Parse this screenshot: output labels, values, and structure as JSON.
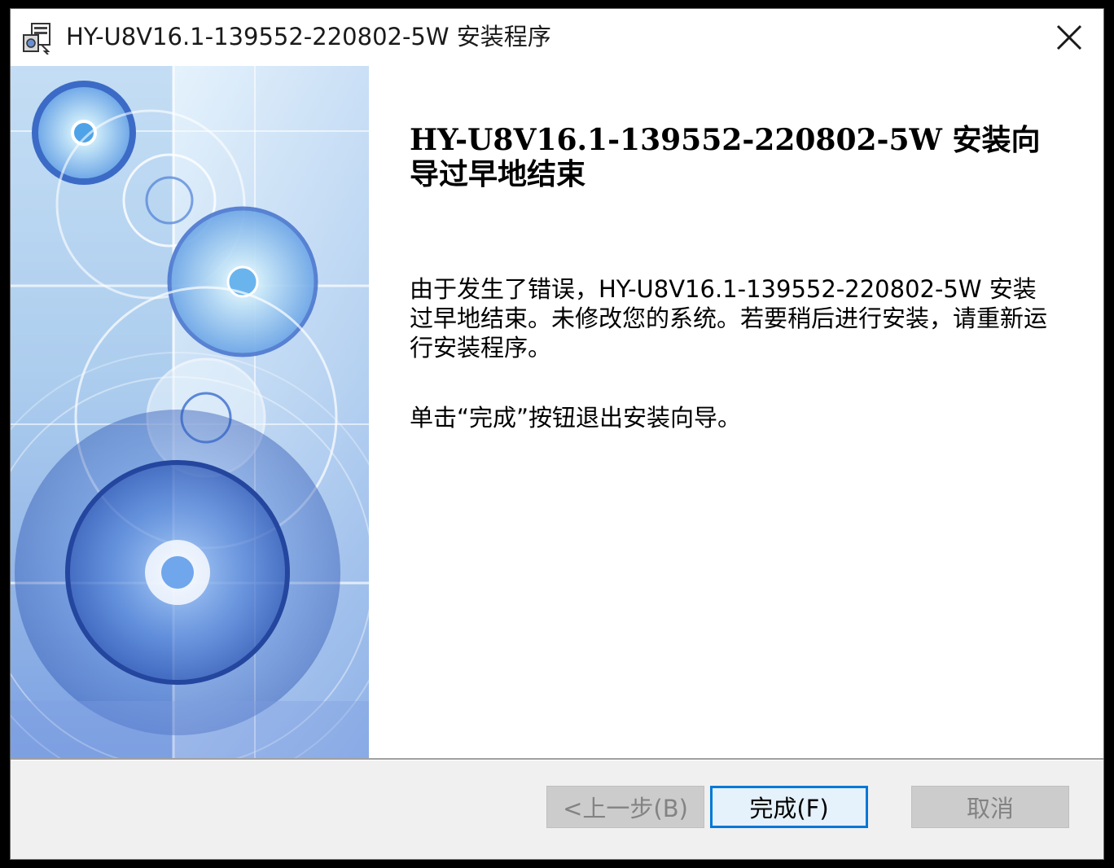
{
  "window": {
    "title": "HY-U8V16.1-139552-220802-5W 安装程序",
    "icon": "installer-icon",
    "close_icon": "close-icon"
  },
  "main": {
    "heading": "HY-U8V16.1-139552-220802-5W 安装向导过早地结束",
    "message": "由于发生了错误，HY-U8V16.1-139552-220802-5W 安装过早地结束。未修改您的系统。若要稍后进行安装，请重新运行安装程序。",
    "hint": "单击“完成”按钮退出安装向导。"
  },
  "footer": {
    "back_label": "<上一步(B)",
    "finish_label": "完成(F)",
    "cancel_label": "取消"
  },
  "colors": {
    "accent": "#0078d7",
    "banner_light": "#dbeefa",
    "banner_dark": "#3a6fc8"
  }
}
